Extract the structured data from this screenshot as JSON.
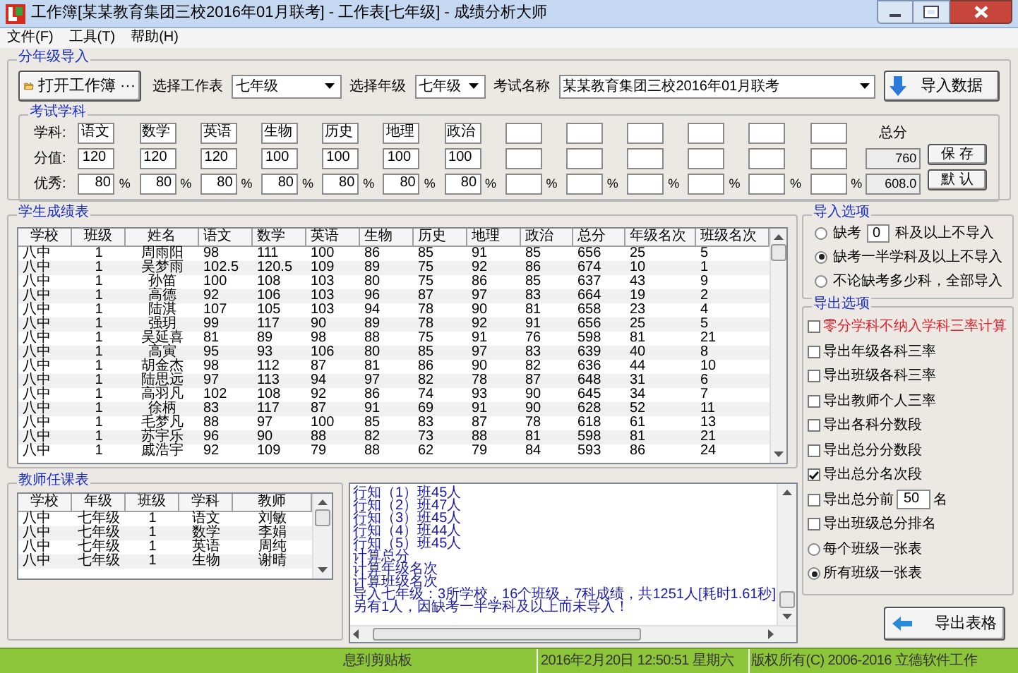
{
  "window": {
    "title": "工作簿[某某教育集团三校2016年01月联考] - 工作表[七年级] - 成绩分析大师"
  },
  "menu": [
    "文件(F)",
    "工具(T)",
    "帮助(H)"
  ],
  "import_group": {
    "title": "分年级导入",
    "open_button": "打开工作簿 ···",
    "sheet_label": "选择工作表",
    "sheet": "七年级",
    "grade_label": "选择年级",
    "grade": "七年级",
    "exam_label": "考试名称",
    "exam": "某某教育集团三校2016年01月联考",
    "import_button": "导入数据"
  },
  "subjects": {
    "title": "考试学科",
    "row_labels": [
      "学科:",
      "分值:",
      "优秀:"
    ],
    "columns": [
      {
        "name": "语文",
        "score": "120",
        "excellent": "80",
        "percent": "%"
      },
      {
        "name": "数学",
        "score": "120",
        "excellent": "80",
        "percent": "%"
      },
      {
        "name": "英语",
        "score": "120",
        "excellent": "80",
        "percent": "%"
      },
      {
        "name": "生物",
        "score": "100",
        "excellent": "80",
        "percent": "%"
      },
      {
        "name": "历史",
        "score": "100",
        "excellent": "80",
        "percent": "%"
      },
      {
        "name": "地理",
        "score": "100",
        "excellent": "80",
        "percent": "%"
      },
      {
        "name": "政治",
        "score": "100",
        "excellent": "80",
        "percent": "%"
      },
      {
        "percent": "%"
      },
      {
        "percent": "%"
      },
      {
        "percent": "%"
      },
      {
        "percent": "%"
      },
      {
        "percent": "%"
      },
      {
        "percent": "%"
      }
    ],
    "total": {
      "label": "总分",
      "score": "760",
      "excellent": "608.0"
    },
    "buttons": [
      "保 存",
      "默 认"
    ]
  },
  "student_table": {
    "title": "学生成绩表",
    "columns": [
      "学校",
      "班级",
      "姓名",
      "语文",
      "数学",
      "英语",
      "生物",
      "历史",
      "地理",
      "政治",
      "总分",
      "年级名次",
      "班级名次"
    ],
    "rows": [
      [
        "八中",
        "1",
        "周雨阳",
        "98",
        "111",
        "100",
        "86",
        "85",
        "91",
        "85",
        "656",
        "25",
        "5"
      ],
      [
        "八中",
        "1",
        "吴梦雨",
        "102.5",
        "120.5",
        "109",
        "89",
        "75",
        "92",
        "86",
        "674",
        "10",
        "1"
      ],
      [
        "八中",
        "1",
        "孙笛",
        "100",
        "108",
        "103",
        "80",
        "75",
        "86",
        "85",
        "637",
        "43",
        "9"
      ],
      [
        "八中",
        "1",
        "高德",
        "92",
        "106",
        "103",
        "96",
        "87",
        "97",
        "83",
        "664",
        "19",
        "2"
      ],
      [
        "八中",
        "1",
        "陆淇",
        "107",
        "105",
        "103",
        "94",
        "78",
        "90",
        "81",
        "658",
        "23",
        "4"
      ],
      [
        "八中",
        "1",
        "强玥",
        "99",
        "117",
        "90",
        "89",
        "78",
        "92",
        "91",
        "656",
        "25",
        "5"
      ],
      [
        "八中",
        "1",
        "吴延喜",
        "81",
        "89",
        "98",
        "88",
        "75",
        "91",
        "76",
        "598",
        "81",
        "21"
      ],
      [
        "八中",
        "1",
        "高寅",
        "95",
        "93",
        "106",
        "80",
        "85",
        "97",
        "83",
        "639",
        "40",
        "8"
      ],
      [
        "八中",
        "1",
        "胡金杰",
        "98",
        "112",
        "87",
        "81",
        "86",
        "90",
        "82",
        "636",
        "44",
        "10"
      ],
      [
        "八中",
        "1",
        "陆思远",
        "97",
        "113",
        "94",
        "97",
        "82",
        "78",
        "87",
        "648",
        "31",
        "6"
      ],
      [
        "八中",
        "1",
        "高羽凡",
        "102",
        "108",
        "92",
        "86",
        "74",
        "93",
        "90",
        "645",
        "34",
        "7"
      ],
      [
        "八中",
        "1",
        "徐柄",
        "83",
        "117",
        "87",
        "91",
        "69",
        "91",
        "90",
        "628",
        "52",
        "11"
      ],
      [
        "八中",
        "1",
        "毛梦凡",
        "88",
        "97",
        "100",
        "85",
        "83",
        "87",
        "78",
        "618",
        "61",
        "13"
      ],
      [
        "八中",
        "1",
        "苏宇乐",
        "96",
        "90",
        "88",
        "82",
        "73",
        "88",
        "81",
        "598",
        "81",
        "21"
      ],
      [
        "八中",
        "1",
        "戚浩宇",
        "92",
        "109",
        "79",
        "88",
        "62",
        "79",
        "84",
        "593",
        "86",
        "24"
      ]
    ]
  },
  "import_options": {
    "title": "导入选项",
    "items": [
      {
        "kind": "count",
        "before": "缺考",
        "value": "0",
        "after": "科及以上不导入",
        "selected": false
      },
      {
        "kind": "plain",
        "label": "缺考一半学科及以上不导入",
        "selected": true
      },
      {
        "kind": "plain",
        "label": "不论缺考多少科，全部导入",
        "selected": false
      }
    ]
  },
  "export_options": {
    "title": "导出选项",
    "items": [
      {
        "kind": "checkbox",
        "label": "零分学科不纳入学科三率计算",
        "checked": false,
        "warning": true
      },
      {
        "kind": "checkbox",
        "label": "导出年级各科三率",
        "checked": false
      },
      {
        "kind": "checkbox",
        "label": "导出班级各科三率",
        "checked": false
      },
      {
        "kind": "checkbox",
        "label": "导出教师个人三率",
        "checked": false
      },
      {
        "kind": "checkbox",
        "label": "导出各科分数段",
        "checked": false
      },
      {
        "kind": "checkbox",
        "label": "导出总分分数段",
        "checked": false
      },
      {
        "kind": "checkbox",
        "label": "导出总分名次段",
        "checked": true
      },
      {
        "kind": "count",
        "before": "导出总分前",
        "value": "50",
        "after": "名",
        "checked": false
      },
      {
        "kind": "checkbox",
        "label": "导出班级总分排名",
        "checked": false
      },
      {
        "kind": "radio",
        "label": "每个班级一张表",
        "selected": false
      },
      {
        "kind": "radio",
        "label": "所有班级一张表",
        "selected": true
      }
    ],
    "export_button": "导出表格"
  },
  "teacher_table": {
    "title": "教师任课表",
    "columns": [
      "学校",
      "年级",
      "班级",
      "学科",
      "教师"
    ],
    "rows": [
      [
        "八中",
        "七年级",
        "1",
        "语文",
        "刘敏"
      ],
      [
        "八中",
        "七年级",
        "1",
        "数学",
        "李娟"
      ],
      [
        "八中",
        "七年级",
        "1",
        "英语",
        "周纯"
      ],
      [
        "八中",
        "七年级",
        "1",
        "生物",
        "谢晴"
      ]
    ]
  },
  "log": [
    "行知（1）班45人",
    "行知（2）班47人",
    "行知（3）班45人",
    "行知（4）班44人",
    "行知（5）班45人",
    "计算总分",
    "计算年级名次",
    "计算班级名次",
    "导入七年级：3所学校，16个班级，7科成绩，共1251人[耗时1.61秒]",
    "另有1人，因缺考一半学科及以上而未导入！"
  ],
  "status_bar": [
    "息到剪贴板",
    "2016年2月20日 12:50:51 星期六",
    "版权所有(C) 2006-2016 立德软件工作"
  ]
}
